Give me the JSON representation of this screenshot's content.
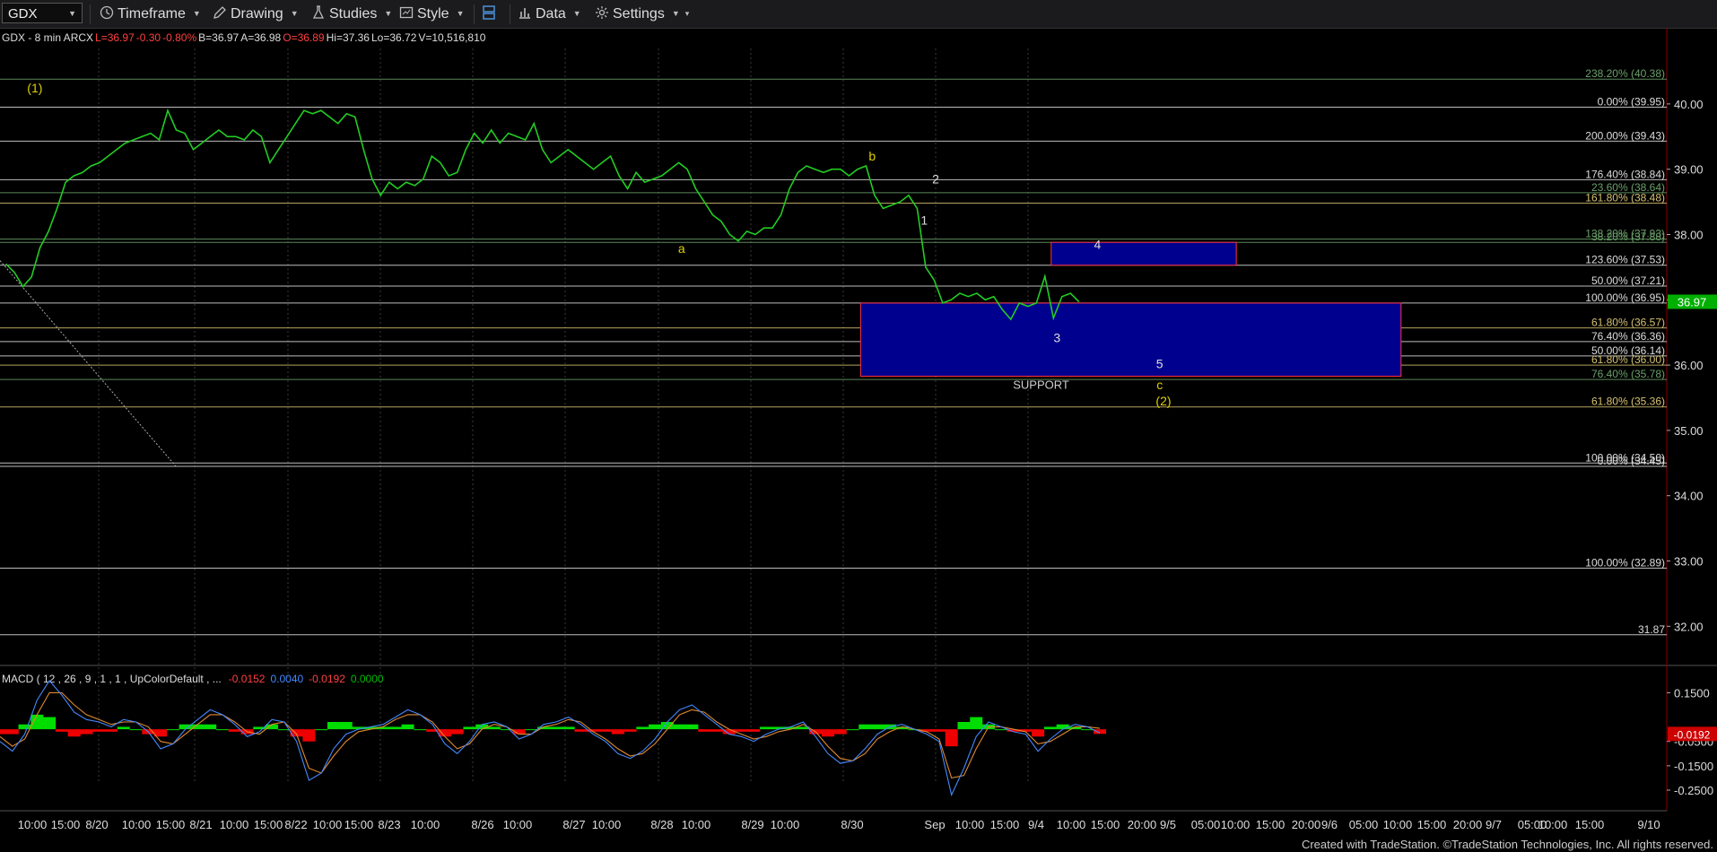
{
  "toolbar": {
    "symbol": "GDX",
    "items": [
      {
        "label": "Timeframe",
        "icon": "clock-icon"
      },
      {
        "label": "Drawing",
        "icon": "pencil-icon"
      },
      {
        "label": "Studies",
        "icon": "flask-icon"
      },
      {
        "label": "Style",
        "icon": "style-icon"
      },
      {
        "label": "",
        "icon": "layout-icon"
      },
      {
        "label": "Data",
        "icon": "bar-chart-icon"
      },
      {
        "label": "Settings",
        "icon": "gear-icon"
      }
    ]
  },
  "header": {
    "parts": [
      {
        "text": "GDX - 8 min  ARCX  ",
        "color": "#dddddd"
      },
      {
        "text": "L=36.97 ",
        "color": "#ff4040"
      },
      {
        "text": "-0.30 ",
        "color": "#ff4040"
      },
      {
        "text": "-0.80% ",
        "color": "#ff4040"
      },
      {
        "text": "B=36.97 ",
        "color": "#dddddd"
      },
      {
        "text": "A=36.98 ",
        "color": "#dddddd"
      },
      {
        "text": "O=36.89 ",
        "color": "#ff4040"
      },
      {
        "text": "Hi=37.36 ",
        "color": "#dddddd"
      },
      {
        "text": "Lo=36.72 ",
        "color": "#dddddd"
      },
      {
        "text": "V=10,516,810",
        "color": "#dddddd"
      }
    ]
  },
  "colors": {
    "price": "#22cc22",
    "fib_gold": "#d4c070",
    "fib_white": "#dddddd",
    "fib_green": "#6aa06a",
    "box_fill": "#00008e",
    "box_border": "#ff3040",
    "macd_up": "#00dd00",
    "macd_down": "#ee0000",
    "last_price": "#00b000"
  },
  "chart_data": [
    {
      "type": "line",
      "title": "GDX - 8 min",
      "ylim": [
        31.4,
        40.85
      ],
      "y_ticks": [
        "40.00",
        "39.00",
        "38.00",
        "37.00",
        "36.00",
        "35.00",
        "34.00",
        "33.00",
        "32.00"
      ],
      "y_tick_values": [
        40,
        39,
        38,
        37,
        36,
        35,
        34,
        33,
        32
      ],
      "last_price": {
        "label": "36.97",
        "value": 36.97
      },
      "x_ticks": [
        "10:00",
        "15:00",
        "8/20",
        "10:00",
        "15:00",
        "8/21",
        "10:00",
        "15:00",
        "8/22",
        "10:00",
        "15:00",
        "8/23",
        "10:00",
        "8/26",
        "10:00",
        "8/27",
        "10:00",
        "8/28",
        "10:00",
        "8/29",
        "10:00",
        "8/30",
        "Sep",
        "10:00",
        "15:00",
        "9/4",
        "10:00",
        "15:00",
        "20:00",
        "9/5",
        "05:00",
        "10:00",
        "15:00",
        "20:00",
        "9/6",
        "05:00",
        "10:00",
        "15:00",
        "20:00",
        "9/7",
        "05:00",
        "10:00",
        "15:00",
        "9/10"
      ],
      "session_dates": [
        "8/20",
        "8/21",
        "8/22",
        "8/23",
        "8/26",
        "8/27",
        "8/28",
        "8/29",
        "8/30",
        "Sep",
        "9/4"
      ],
      "series": [
        {
          "values": [
            37.55,
            37.42,
            37.2,
            37.35,
            37.8,
            38.05,
            38.4,
            38.8,
            38.9,
            38.95,
            39.05,
            39.1,
            39.2,
            39.3,
            39.4,
            39.45,
            39.5,
            39.55,
            39.45,
            39.9,
            39.6,
            39.55,
            39.3,
            39.4,
            39.5,
            39.6,
            39.5,
            39.5,
            39.45,
            39.6,
            39.5,
            39.1,
            39.3,
            39.5,
            39.7,
            39.9,
            39.85,
            39.9,
            39.8,
            39.7,
            39.85,
            39.8,
            39.3,
            38.85,
            38.6,
            38.8,
            38.7,
            38.8,
            38.75,
            38.85,
            39.2,
            39.1,
            38.9,
            38.95,
            39.3,
            39.55,
            39.4,
            39.6,
            39.4,
            39.55,
            39.5,
            39.45,
            39.7,
            39.3,
            39.1,
            39.2,
            39.3,
            39.2,
            39.1,
            39.0,
            39.1,
            39.2,
            38.9,
            38.7,
            38.95,
            38.8,
            38.85,
            38.9,
            39.0,
            39.1,
            39.0,
            38.7,
            38.5,
            38.3,
            38.2,
            38.0,
            37.9,
            38.05,
            38.0,
            38.1,
            38.1,
            38.3,
            38.7,
            38.95,
            39.05,
            39.0,
            38.95,
            39.0,
            39.0,
            38.9,
            39.0,
            39.05,
            38.6,
            38.4,
            38.45,
            38.5,
            38.6,
            38.4,
            37.5,
            37.3,
            36.95,
            37.0,
            37.1,
            37.05,
            37.1,
            37.0,
            37.05,
            36.85,
            36.7,
            36.95,
            36.9,
            36.95,
            37.36,
            36.72,
            37.05,
            37.1,
            36.97
          ]
        }
      ],
      "price_x_range": [
        "2019-08-19 08:00",
        "2019-09-04 12:24"
      ],
      "fib_levels": [
        {
          "label": "238.20% (40.38)",
          "value": 40.38,
          "color": "#6aa06a"
        },
        {
          "label": "0.00% (39.95)",
          "value": 39.95,
          "color": "#dddddd"
        },
        {
          "label": "200.00% (39.43)",
          "value": 39.43,
          "color": "#dddddd"
        },
        {
          "label": "176.40% (38.84)",
          "value": 38.84,
          "color": "#dddddd"
        },
        {
          "label": "23.60% (38.64)",
          "value": 38.64,
          "color": "#6aa06a"
        },
        {
          "label": "161.80% (38.48)",
          "value": 38.48,
          "color": "#d4c070"
        },
        {
          "label": "138.20% (37.93)",
          "value": 37.93,
          "color": "#6aa06a"
        },
        {
          "label": "38.20% (37.88)",
          "value": 37.88,
          "color": "#6aa06a"
        },
        {
          "label": "123.60% (37.53)",
          "value": 37.53,
          "color": "#dddddd"
        },
        {
          "label": "50.00% (37.21)",
          "value": 37.21,
          "color": "#dddddd"
        },
        {
          "label": "100.00% (36.95)",
          "value": 36.95,
          "color": "#dddddd"
        },
        {
          "label": "61.80% (36.57)",
          "value": 36.57,
          "color": "#d4c070"
        },
        {
          "label": "76.40% (36.36)",
          "value": 36.36,
          "color": "#dddddd"
        },
        {
          "label": "50.00% (36.14)",
          "value": 36.14,
          "color": "#dddddd"
        },
        {
          "label": "61.80% (36.00)",
          "value": 36.0,
          "color": "#d4c070"
        },
        {
          "label": "76.40% (35.78)",
          "value": 35.78,
          "color": "#6aa06a"
        },
        {
          "label": "61.80% (35.36)",
          "value": 35.36,
          "color": "#d4c070"
        },
        {
          "label": "100.00% (34.50)",
          "value": 34.5,
          "color": "#dddddd"
        },
        {
          "label": "0.00% (34.45)",
          "value": 34.45,
          "color": "#dddddd"
        },
        {
          "label": "100.00% (32.89)",
          "value": 32.89,
          "color": "#dddddd"
        },
        {
          "label": "31.87",
          "value": 31.87,
          "color": "#dddddd"
        }
      ],
      "zones": [
        {
          "label": "SUPPORT",
          "from_x": "2019-08-30 09:30",
          "to_x": "2019-09-06 12:30",
          "y_top": 36.95,
          "y_bottom": 35.83
        },
        {
          "label": "",
          "from_x": "2019-09-04 10:00",
          "to_x": "2019-09-05 15:00",
          "y_top": 37.88,
          "y_bottom": 37.53
        }
      ],
      "wave_labels": [
        {
          "text": "(1)",
          "x": "2019-08-19 10:30",
          "y": 40.18,
          "color": "#e0d000"
        },
        {
          "text": "a",
          "x": "2019-08-28 10:00",
          "y": 37.72,
          "color": "#e0d000"
        },
        {
          "text": "b",
          "x": "2019-08-30 10:30",
          "y": 39.13,
          "color": "#e0d000"
        },
        {
          "text": "1",
          "x": "2019-08-30 15:00",
          "y": 38.15,
          "color": "#dddddd"
        },
        {
          "text": "2",
          "x": "2019-09-03 08:00",
          "y": 38.78,
          "color": "#dddddd"
        },
        {
          "text": "3",
          "x": "2019-09-04 10:30",
          "y": 36.35,
          "color": "#dddddd"
        },
        {
          "text": "4",
          "x": "2019-09-04 14:00",
          "y": 37.78,
          "color": "#dddddd"
        },
        {
          "text": "5",
          "x": "2019-09-05 05:00",
          "y": 35.95,
          "color": "#dddddd"
        },
        {
          "text": "c",
          "x": "2019-09-05 05:00",
          "y": 35.63,
          "color": "#e0d000"
        },
        {
          "text": "(2)",
          "x": "2019-09-05 05:30",
          "y": 35.38,
          "color": "#e0d000"
        }
      ]
    },
    {
      "type": "bar",
      "title": "MACD ( 12 , 26 , 9 , 1 , 1 , UpColorDefault , ...",
      "legend_values": [
        {
          "text": "-0.0152",
          "color": "#ff4040"
        },
        {
          "text": "0.0040",
          "color": "#4488ff"
        },
        {
          "text": "-0.0192",
          "color": "#ff4040"
        },
        {
          "text": "0.0000",
          "color": "#00bb00"
        }
      ],
      "ylim": [
        -0.32,
        0.24
      ],
      "y_ticks": [
        "0.1500",
        "-0.0500",
        "-0.1500",
        "-0.2500"
      ],
      "y_tick_values": [
        0.15,
        -0.05,
        -0.15,
        -0.25
      ],
      "last_value_label": "-0.0192",
      "last_value": -0.0192,
      "series": [
        {
          "name": "MACD",
          "values": [
            -0.05,
            -0.09,
            -0.02,
            0.12,
            0.2,
            0.14,
            0.07,
            0.04,
            0.03,
            0.01,
            0.04,
            0.03,
            -0.01,
            -0.08,
            -0.06,
            0.0,
            0.04,
            0.08,
            0.06,
            0.02,
            -0.03,
            -0.01,
            0.04,
            0.03,
            -0.05,
            -0.21,
            -0.18,
            -0.08,
            -0.02,
            0.0,
            0.01,
            0.02,
            0.05,
            0.08,
            0.06,
            0.02,
            -0.06,
            -0.1,
            -0.05,
            0.02,
            0.03,
            0.01,
            -0.04,
            -0.02,
            0.02,
            0.03,
            0.05,
            0.02,
            -0.02,
            -0.05,
            -0.1,
            -0.12,
            -0.09,
            -0.04,
            0.03,
            0.08,
            0.1,
            0.06,
            0.02,
            -0.02,
            -0.03,
            -0.05,
            -0.02,
            0.0,
            0.01,
            0.03,
            -0.03,
            -0.1,
            -0.14,
            -0.13,
            -0.08,
            -0.02,
            0.01,
            0.02,
            0.0,
            -0.02,
            -0.05,
            -0.27,
            -0.16,
            -0.03,
            0.03,
            0.01,
            -0.01,
            -0.02,
            -0.09,
            -0.04,
            0.0,
            0.02,
            0.01,
            -0.015
          ]
        },
        {
          "name": "Signal",
          "values": [
            -0.03,
            -0.07,
            -0.04,
            0.06,
            0.15,
            0.15,
            0.1,
            0.06,
            0.04,
            0.02,
            0.03,
            0.03,
            0.01,
            -0.05,
            -0.06,
            -0.02,
            0.02,
            0.06,
            0.06,
            0.03,
            -0.01,
            -0.02,
            0.02,
            0.03,
            -0.02,
            -0.16,
            -0.18,
            -0.11,
            -0.05,
            -0.01,
            0.0,
            0.01,
            0.04,
            0.06,
            0.06,
            0.03,
            -0.03,
            -0.08,
            -0.06,
            0.0,
            0.02,
            0.01,
            -0.02,
            -0.02,
            0.01,
            0.02,
            0.04,
            0.03,
            -0.01,
            -0.04,
            -0.08,
            -0.11,
            -0.1,
            -0.06,
            0.0,
            0.06,
            0.08,
            0.07,
            0.03,
            0.0,
            -0.02,
            -0.04,
            -0.03,
            -0.01,
            0.0,
            0.02,
            -0.01,
            -0.07,
            -0.12,
            -0.13,
            -0.1,
            -0.04,
            -0.01,
            0.01,
            0.0,
            -0.01,
            -0.04,
            -0.2,
            -0.19,
            -0.08,
            0.01,
            0.01,
            0.0,
            -0.01,
            -0.06,
            -0.05,
            -0.02,
            0.01,
            0.01,
            0.004
          ]
        },
        {
          "name": "Histogram",
          "values": [
            -0.02,
            -0.02,
            0.02,
            0.06,
            0.05,
            -0.01,
            -0.03,
            -0.02,
            -0.01,
            -0.01,
            0.01,
            0.0,
            -0.02,
            -0.03,
            0.0,
            0.02,
            0.02,
            0.02,
            0.0,
            -0.01,
            -0.02,
            0.01,
            0.02,
            0.0,
            -0.03,
            -0.05,
            0.0,
            0.03,
            0.03,
            0.01,
            0.01,
            0.01,
            0.01,
            0.02,
            0.0,
            -0.01,
            -0.03,
            -0.02,
            0.01,
            0.02,
            0.01,
            0.0,
            -0.02,
            0.0,
            0.01,
            0.01,
            0.01,
            -0.01,
            -0.01,
            -0.01,
            -0.02,
            -0.01,
            0.01,
            0.02,
            0.03,
            0.02,
            0.02,
            -0.01,
            -0.01,
            -0.02,
            -0.01,
            -0.01,
            0.01,
            0.01,
            0.01,
            0.01,
            -0.02,
            -0.03,
            -0.02,
            0.0,
            0.02,
            0.02,
            0.02,
            0.01,
            0.0,
            -0.01,
            -0.01,
            -0.07,
            0.03,
            0.05,
            0.02,
            0.0,
            -0.01,
            -0.01,
            -0.03,
            0.01,
            0.02,
            0.01,
            0.0,
            -0.019
          ]
        }
      ]
    }
  ],
  "footer": "Created with TradeStation. ©TradeStation Technologies, Inc. All rights reserved."
}
